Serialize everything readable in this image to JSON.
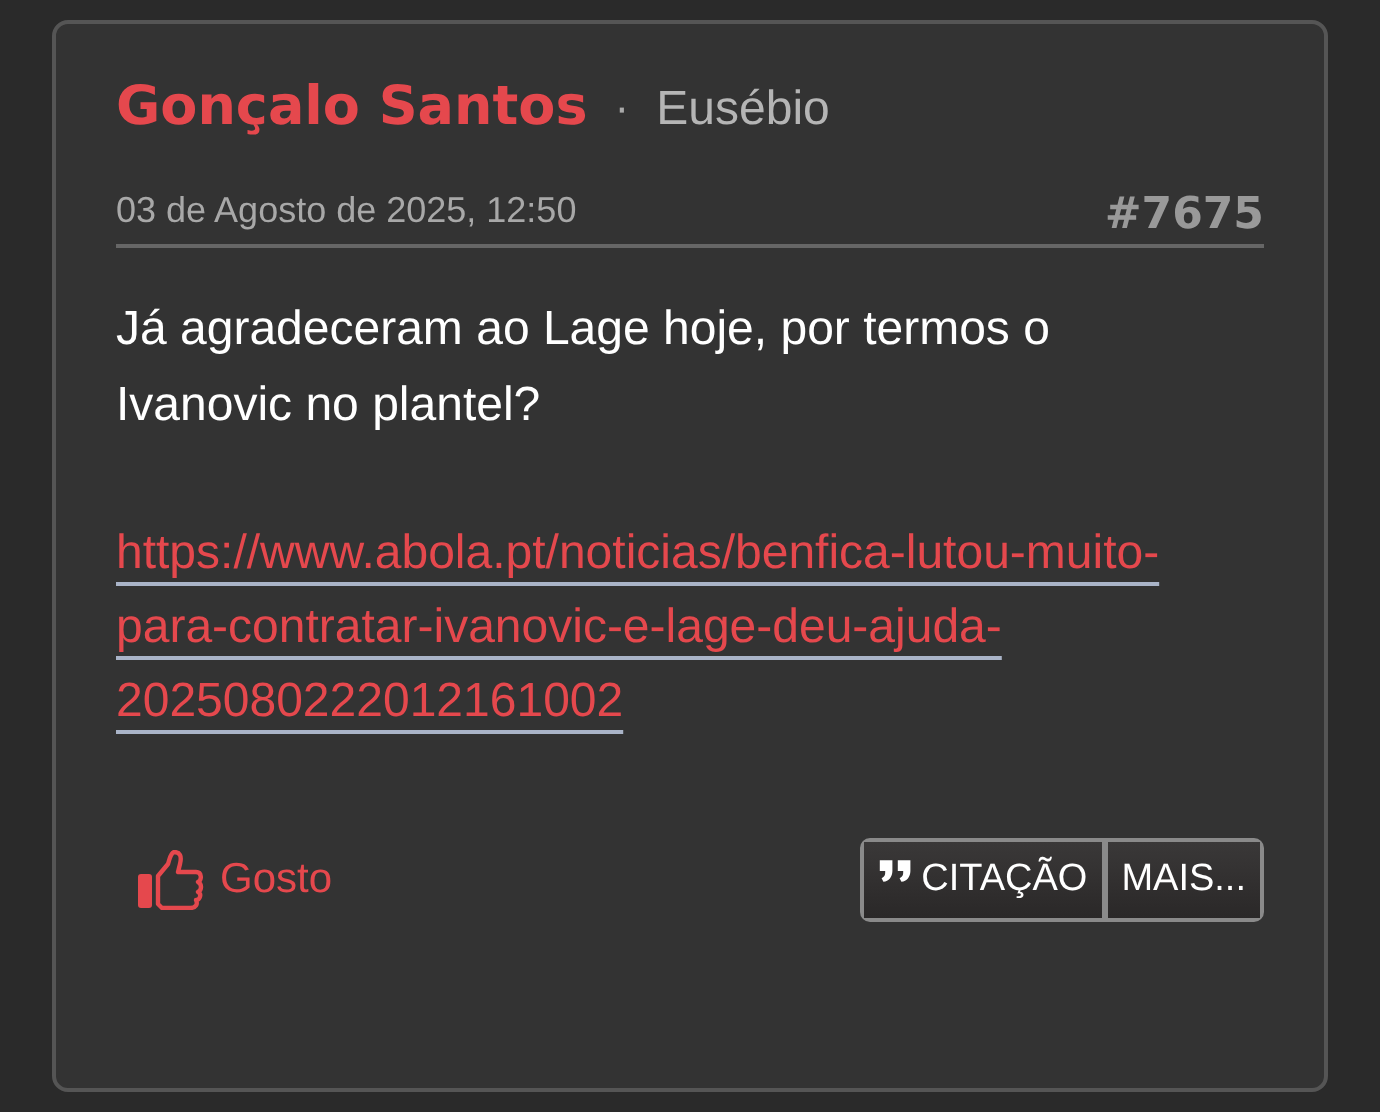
{
  "post": {
    "author": "Gonçalo Santos",
    "separator": "·",
    "rank": "Eusébio",
    "date": "03 de Agosto de 2025, 12:50",
    "number": "#7675",
    "text": "Já agradeceram ao Lage hoje, por termos o Ivanovic no plantel?",
    "link": "https://www.abola.pt/noticias/benfica-lutou-muito-para-contratar-ivanovic-e-lage-deu-ajuda-2025080222012161002"
  },
  "like": {
    "label": "Gosto"
  },
  "buttons": [
    {
      "kind": "quote",
      "label": "CITAÇÃO"
    },
    {
      "kind": "more",
      "label": "MAIS..."
    }
  ]
}
